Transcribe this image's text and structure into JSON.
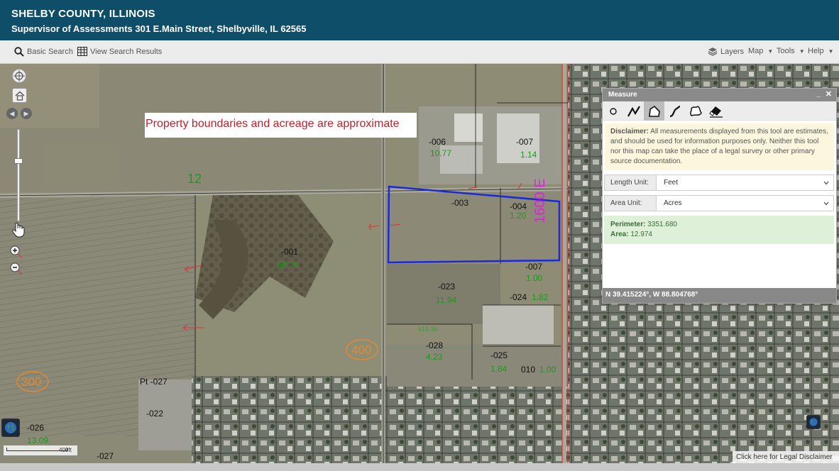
{
  "header": {
    "title": "SHELBY COUNTY, ILLINOIS",
    "subtitle": "Supervisor of Assessments 301 E.Main Street, Shelbyville, IL 62565"
  },
  "toolbar": {
    "basic_search": "Basic Search",
    "view_results": "View Search Results",
    "layers": "Layers",
    "map": "Map",
    "tools": "Tools",
    "help": "Help"
  },
  "map": {
    "notice": "Property boundaries and acreage are approximate",
    "road_12": "12",
    "road_1600e": "1600 E",
    "contour_400": "400",
    "contour_300": "300",
    "scale_label": "400ft",
    "legal_link": "Click here for Legal Disclaimer",
    "parcels": [
      {
        "id": "-006",
        "acres": "10.77"
      },
      {
        "id": "-007",
        "acres": "1.14"
      },
      {
        "id": "-003",
        "acres": ""
      },
      {
        "id": "-004",
        "acres": "1.20"
      },
      {
        "id": "-001",
        "acres": "60.29"
      },
      {
        "id": "-007",
        "acres": "1.00"
      },
      {
        "id": "-023",
        "acres": "11.94"
      },
      {
        "id": "-024",
        "acres": "1.82"
      },
      {
        "id": "-028",
        "acres": "4.23"
      },
      {
        "id": "-025",
        "acres": "1.84"
      },
      {
        "id": "010",
        "acres": "1.00"
      },
      {
        "id": "Pt -027",
        "acres": ""
      },
      {
        "id": "-022",
        "acres": ""
      },
      {
        "id": "-026",
        "acres": "13.09"
      },
      {
        "id": "-027",
        "acres": ""
      }
    ],
    "dimension": "610.36"
  },
  "measure": {
    "title": "Measure",
    "disclaimer_label": "Disclaimer:",
    "disclaimer_text": " All measurements displayed from this tool are estimates, and should be used for information purposes only. Neither this tool nor this map can take the place of a legal survey or other primary source documentation.",
    "length_label": "Length Unit:",
    "length_value": "Feet",
    "area_label": "Area Unit:",
    "area_value": "Acres",
    "perimeter_label": "Perimeter:",
    "perimeter_value": " 3351.680",
    "area_result_label": "Area:",
    "area_result_value": " 12.974",
    "coords": "N 39.415224°, W 88.804768°"
  },
  "colors": {
    "header_bg": "#0f4e69",
    "measure_polygon": "#1a2bd6",
    "notice_text": "#c0202a"
  }
}
